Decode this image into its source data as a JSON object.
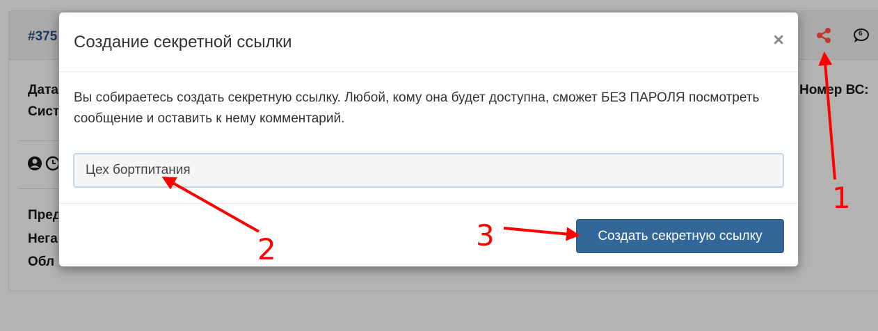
{
  "background": {
    "record_id": "#375",
    "left_labels": [
      "Дата",
      "Сист",
      "Пред",
      "Нега",
      "Обл"
    ],
    "right_label": "Номер ВС:",
    "notification_count": "6"
  },
  "modal": {
    "title": "Создание секретной ссылки",
    "close_symbol": "×",
    "body_text": "Вы собираетесь создать секретную ссылку. Любой, кому она будет доступна, сможет БЕЗ ПАРОЛЯ посмотреть сообщение и оставить к нему комментарий.",
    "input_value": "Цех бортпитания",
    "submit_label": "Создать секретную ссылку"
  },
  "annotations": {
    "step1": "1",
    "step2": "2",
    "step3": "3",
    "color": "#ff0000"
  },
  "colors": {
    "primary": "#336699",
    "share_icon": "#c0392b",
    "overlay": "#b3b3b3"
  }
}
